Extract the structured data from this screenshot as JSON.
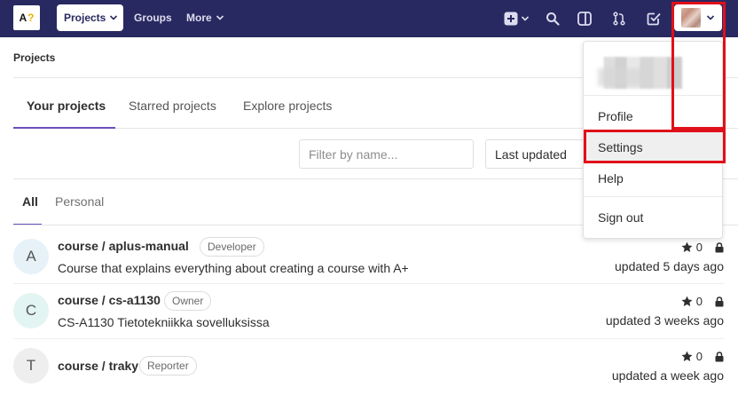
{
  "navbar": {
    "logo_text": "A",
    "logo_mark": "?",
    "projects_label": "Projects",
    "groups_label": "Groups",
    "more_label": "More",
    "icons": [
      "plus-square-icon",
      "search-icon",
      "issues-panel-icon",
      "merge-request-icon",
      "todo-check-icon"
    ],
    "bg_color": "#292961"
  },
  "breadcrumb": "Projects",
  "tabs": [
    {
      "label": "Your projects",
      "active": true
    },
    {
      "label": "Starred projects",
      "active": false
    },
    {
      "label": "Explore projects",
      "active": false
    }
  ],
  "filter": {
    "placeholder": "Filter by name...",
    "value": "",
    "sort_label": "Last updated"
  },
  "subtabs": [
    {
      "label": "All",
      "active": true
    },
    {
      "label": "Personal",
      "active": false
    }
  ],
  "projects": [
    {
      "avatar": "A",
      "title": "course / aplus-manual",
      "role": "Developer",
      "description": "Course that explains everything about creating a course with A+",
      "stars": "0",
      "updated": "updated 5 days ago"
    },
    {
      "avatar": "C",
      "title": "course / cs-a1130",
      "role": "Owner",
      "description": "CS-A1130 Tietotekniikka sovelluksissa",
      "stars": "0",
      "updated": "updated 3 weeks ago"
    },
    {
      "avatar": "T",
      "title": "course / traky",
      "role": "Reporter",
      "description": "",
      "stars": "0",
      "updated": "updated a week ago"
    }
  ],
  "user_menu": {
    "items": [
      {
        "label": "Profile"
      },
      {
        "label": "Settings"
      },
      {
        "label": "Help"
      },
      {
        "label": "Sign out"
      }
    ]
  },
  "colors": {
    "accent": "#6b4fbb",
    "highlight": "#e0101a"
  }
}
